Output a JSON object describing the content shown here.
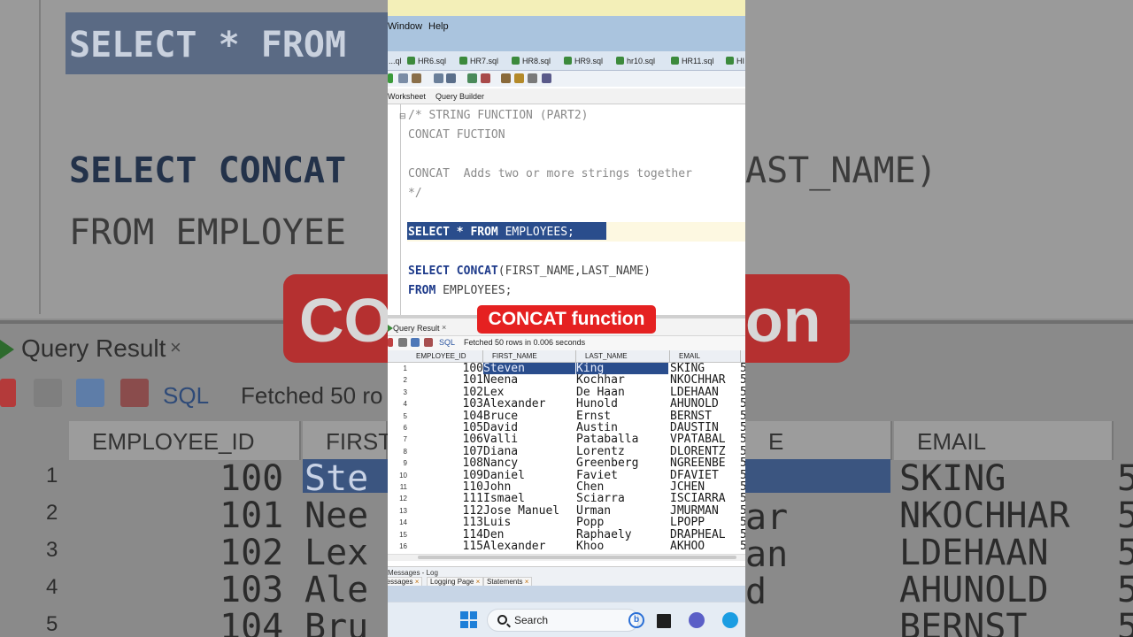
{
  "background": {
    "select_line": "SELECT * FROM",
    "concat_line": "SELECT CONCAT",
    "concat_trail": "AST_NAME)",
    "from_line": "FROM EMPLOYEE",
    "banner_left": "CO",
    "banner_right": "on",
    "result_tab": "Query Result",
    "result_tab_close": "×",
    "sql_label": "SQL",
    "fetched": "Fetched 50 ro",
    "headers": [
      "EMPLOYEE_ID",
      "FIRST",
      "E",
      "EMAIL"
    ],
    "rows": [
      {
        "n": "1",
        "id": "100",
        "fn": "Ste",
        "email": "SKING",
        "mid": ""
      },
      {
        "n": "2",
        "id": "101",
        "fn": "Nee",
        "email": "NKOCHHAR",
        "mid": "ar"
      },
      {
        "n": "3",
        "id": "102",
        "fn": "Lex",
        "email": "LDEHAAN",
        "mid": "an"
      },
      {
        "n": "4",
        "id": "103",
        "fn": "Ale",
        "email": "AHUNOLD",
        "mid": "d"
      },
      {
        "n": "5",
        "id": "104",
        "fn": "Bru",
        "email": "BERNST",
        "mid": ""
      }
    ],
    "trailing_digit": "5"
  },
  "menu": {
    "window": "Window",
    "help": "Help"
  },
  "file_tabs": [
    "...ql",
    "HR6.sql",
    "HR7.sql",
    "HR8.sql",
    "HR9.sql",
    "hr10.sql",
    "HR11.sql",
    "HI"
  ],
  "sub_tabs": {
    "worksheet": "Worksheet",
    "query_builder": "Query Builder"
  },
  "editor": {
    "lines": [
      "/* STRING FUNCTION (PART2)",
      "CONCAT FUCTION",
      "CONCAT  Adds two or more strings together",
      "*/"
    ],
    "select_kw1": "SELECT",
    "select_star": "*",
    "select_kw2": "FROM",
    "select_tail": "EMPLOYEES;",
    "concat_kw1": "SELECT",
    "concat_kw2": "CONCAT",
    "concat_args": "(FIRST_NAME,LAST_NAME)",
    "from_kw": "FROM",
    "from_tail": "EMPLOYEES;"
  },
  "results": {
    "tab_label": "Query Result",
    "tab_close": "×",
    "sql_label": "SQL",
    "status": "Fetched 50 rows in 0.006 seconds",
    "columns": [
      "EMPLOYEE_ID",
      "FIRST_NAME",
      "LAST_NAME",
      "EMAIL"
    ],
    "rows": [
      {
        "n": "1",
        "id": "100",
        "first": "Steven",
        "last": "King",
        "email": "SKING",
        "x": "5"
      },
      {
        "n": "2",
        "id": "101",
        "first": "Neena",
        "last": "Kochhar",
        "email": "NKOCHHAR",
        "x": "5"
      },
      {
        "n": "3",
        "id": "102",
        "first": "Lex",
        "last": "De Haan",
        "email": "LDEHAAN",
        "x": "5"
      },
      {
        "n": "4",
        "id": "103",
        "first": "Alexander",
        "last": "Hunold",
        "email": "AHUNOLD",
        "x": "5"
      },
      {
        "n": "5",
        "id": "104",
        "first": "Bruce",
        "last": "Ernst",
        "email": "BERNST",
        "x": "5"
      },
      {
        "n": "6",
        "id": "105",
        "first": "David",
        "last": "Austin",
        "email": "DAUSTIN",
        "x": "5"
      },
      {
        "n": "7",
        "id": "106",
        "first": "Valli",
        "last": "Pataballa",
        "email": "VPATABAL",
        "x": "5"
      },
      {
        "n": "8",
        "id": "107",
        "first": "Diana",
        "last": "Lorentz",
        "email": "DLORENTZ",
        "x": "5"
      },
      {
        "n": "9",
        "id": "108",
        "first": "Nancy",
        "last": "Greenberg",
        "email": "NGREENBE",
        "x": "5"
      },
      {
        "n": "10",
        "id": "109",
        "first": "Daniel",
        "last": "Faviet",
        "email": "DFAVIET",
        "x": "5"
      },
      {
        "n": "11",
        "id": "110",
        "first": "John",
        "last": "Chen",
        "email": "JCHEN",
        "x": "5"
      },
      {
        "n": "12",
        "id": "111",
        "first": "Ismael",
        "last": "Sciarra",
        "email": "ISCIARRA",
        "x": "5"
      },
      {
        "n": "13",
        "id": "112",
        "first": "Jose Manuel",
        "last": "Urman",
        "email": "JMURMAN",
        "x": "5"
      },
      {
        "n": "14",
        "id": "113",
        "first": "Luis",
        "last": "Popp",
        "email": "LPOPP",
        "x": "5"
      },
      {
        "n": "15",
        "id": "114",
        "first": "Den",
        "last": "Raphaely",
        "email": "DRAPHEAL",
        "x": "5"
      },
      {
        "n": "16",
        "id": "115",
        "first": "Alexander",
        "last": "Khoo",
        "email": "AKHOO",
        "x": "5"
      }
    ]
  },
  "messages": {
    "header": "Messages - Log",
    "tabs": [
      "Messages",
      "Logging Page",
      "Statements"
    ],
    "close": "×"
  },
  "taskbar": {
    "search": "Search",
    "bing": "b"
  },
  "caption": "CONCAT function",
  "colors": {
    "selection": "#2a4d8c",
    "keyword": "#1d3a8a",
    "caption_bg": "#e52121",
    "menubar": "#aac4de"
  }
}
